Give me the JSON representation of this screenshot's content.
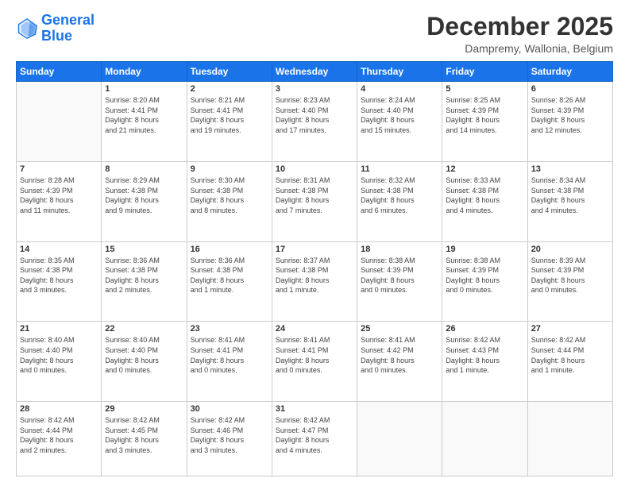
{
  "header": {
    "logo_line1": "General",
    "logo_line2": "Blue",
    "month_title": "December 2025",
    "subtitle": "Dampremy, Wallonia, Belgium"
  },
  "days_of_week": [
    "Sunday",
    "Monday",
    "Tuesday",
    "Wednesday",
    "Thursday",
    "Friday",
    "Saturday"
  ],
  "weeks": [
    [
      {
        "day": "",
        "info": ""
      },
      {
        "day": "1",
        "info": "Sunrise: 8:20 AM\nSunset: 4:41 PM\nDaylight: 8 hours\nand 21 minutes."
      },
      {
        "day": "2",
        "info": "Sunrise: 8:21 AM\nSunset: 4:41 PM\nDaylight: 8 hours\nand 19 minutes."
      },
      {
        "day": "3",
        "info": "Sunrise: 8:23 AM\nSunset: 4:40 PM\nDaylight: 8 hours\nand 17 minutes."
      },
      {
        "day": "4",
        "info": "Sunrise: 8:24 AM\nSunset: 4:40 PM\nDaylight: 8 hours\nand 15 minutes."
      },
      {
        "day": "5",
        "info": "Sunrise: 8:25 AM\nSunset: 4:39 PM\nDaylight: 8 hours\nand 14 minutes."
      },
      {
        "day": "6",
        "info": "Sunrise: 8:26 AM\nSunset: 4:39 PM\nDaylight: 8 hours\nand 12 minutes."
      }
    ],
    [
      {
        "day": "7",
        "info": "Sunrise: 8:28 AM\nSunset: 4:39 PM\nDaylight: 8 hours\nand 11 minutes."
      },
      {
        "day": "8",
        "info": "Sunrise: 8:29 AM\nSunset: 4:38 PM\nDaylight: 8 hours\nand 9 minutes."
      },
      {
        "day": "9",
        "info": "Sunrise: 8:30 AM\nSunset: 4:38 PM\nDaylight: 8 hours\nand 8 minutes."
      },
      {
        "day": "10",
        "info": "Sunrise: 8:31 AM\nSunset: 4:38 PM\nDaylight: 8 hours\nand 7 minutes."
      },
      {
        "day": "11",
        "info": "Sunrise: 8:32 AM\nSunset: 4:38 PM\nDaylight: 8 hours\nand 6 minutes."
      },
      {
        "day": "12",
        "info": "Sunrise: 8:33 AM\nSunset: 4:38 PM\nDaylight: 8 hours\nand 4 minutes."
      },
      {
        "day": "13",
        "info": "Sunrise: 8:34 AM\nSunset: 4:38 PM\nDaylight: 8 hours\nand 4 minutes."
      }
    ],
    [
      {
        "day": "14",
        "info": "Sunrise: 8:35 AM\nSunset: 4:38 PM\nDaylight: 8 hours\nand 3 minutes."
      },
      {
        "day": "15",
        "info": "Sunrise: 8:36 AM\nSunset: 4:38 PM\nDaylight: 8 hours\nand 2 minutes."
      },
      {
        "day": "16",
        "info": "Sunrise: 8:36 AM\nSunset: 4:38 PM\nDaylight: 8 hours\nand 1 minute."
      },
      {
        "day": "17",
        "info": "Sunrise: 8:37 AM\nSunset: 4:38 PM\nDaylight: 8 hours\nand 1 minute."
      },
      {
        "day": "18",
        "info": "Sunrise: 8:38 AM\nSunset: 4:39 PM\nDaylight: 8 hours\nand 0 minutes."
      },
      {
        "day": "19",
        "info": "Sunrise: 8:38 AM\nSunset: 4:39 PM\nDaylight: 8 hours\nand 0 minutes."
      },
      {
        "day": "20",
        "info": "Sunrise: 8:39 AM\nSunset: 4:39 PM\nDaylight: 8 hours\nand 0 minutes."
      }
    ],
    [
      {
        "day": "21",
        "info": "Sunrise: 8:40 AM\nSunset: 4:40 PM\nDaylight: 8 hours\nand 0 minutes."
      },
      {
        "day": "22",
        "info": "Sunrise: 8:40 AM\nSunset: 4:40 PM\nDaylight: 8 hours\nand 0 minutes."
      },
      {
        "day": "23",
        "info": "Sunrise: 8:41 AM\nSunset: 4:41 PM\nDaylight: 8 hours\nand 0 minutes."
      },
      {
        "day": "24",
        "info": "Sunrise: 8:41 AM\nSunset: 4:41 PM\nDaylight: 8 hours\nand 0 minutes."
      },
      {
        "day": "25",
        "info": "Sunrise: 8:41 AM\nSunset: 4:42 PM\nDaylight: 8 hours\nand 0 minutes."
      },
      {
        "day": "26",
        "info": "Sunrise: 8:42 AM\nSunset: 4:43 PM\nDaylight: 8 hours\nand 1 minute."
      },
      {
        "day": "27",
        "info": "Sunrise: 8:42 AM\nSunset: 4:44 PM\nDaylight: 8 hours\nand 1 minute."
      }
    ],
    [
      {
        "day": "28",
        "info": "Sunrise: 8:42 AM\nSunset: 4:44 PM\nDaylight: 8 hours\nand 2 minutes."
      },
      {
        "day": "29",
        "info": "Sunrise: 8:42 AM\nSunset: 4:45 PM\nDaylight: 8 hours\nand 3 minutes."
      },
      {
        "day": "30",
        "info": "Sunrise: 8:42 AM\nSunset: 4:46 PM\nDaylight: 8 hours\nand 3 minutes."
      },
      {
        "day": "31",
        "info": "Sunrise: 8:42 AM\nSunset: 4:47 PM\nDaylight: 8 hours\nand 4 minutes."
      },
      {
        "day": "",
        "info": ""
      },
      {
        "day": "",
        "info": ""
      },
      {
        "day": "",
        "info": ""
      }
    ]
  ]
}
